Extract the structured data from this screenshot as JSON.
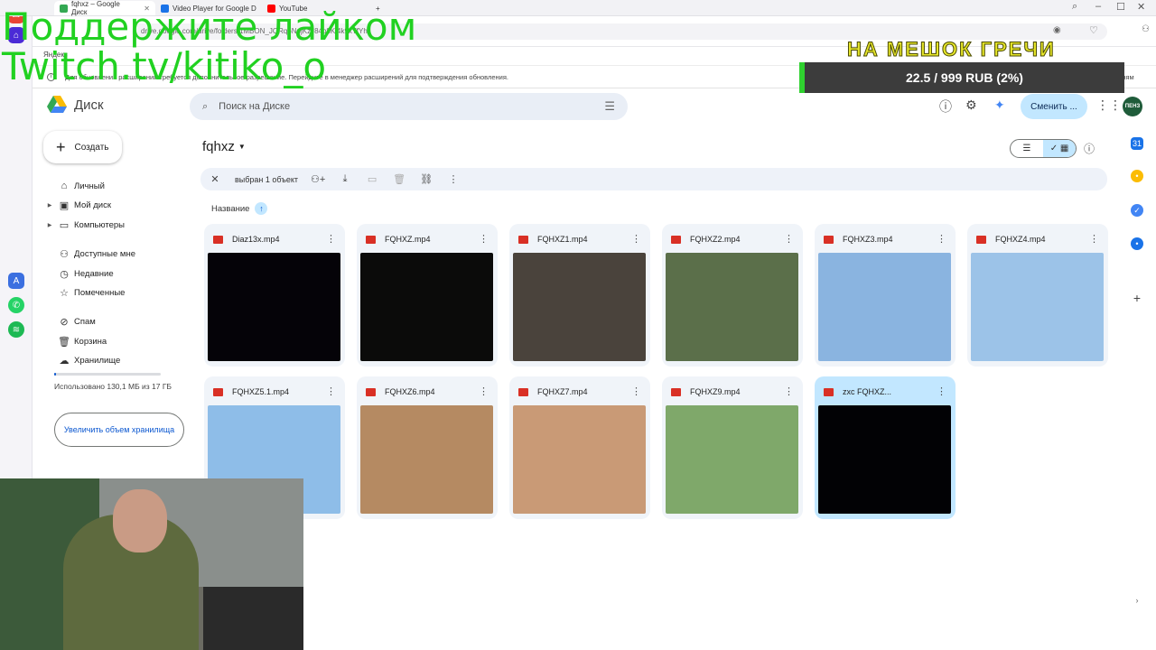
{
  "browser": {
    "tabs": [
      {
        "title": "fqhxz – Google Диск",
        "active": true
      },
      {
        "title": "Video Player for Google D",
        "active": false
      },
      {
        "title": "YouTube",
        "active": false
      }
    ],
    "new_tab": "+",
    "url": "drive.google.com/drive/folders/1MBON_JQRq6NpjKzJ84p8Kj4k9xTfYh",
    "bookmark": "Яндекс",
    "notice": "Для обновления расширений требуется дополнительное разрешение. Перейдите в менеджер расширений для подтверждения обновления.",
    "notice_button": "...ням"
  },
  "drive": {
    "logo": "Диск",
    "search_placeholder": "Поиск на Диске",
    "switch_button": "Сменить ...",
    "account": "ПЕНЗ",
    "create_label": "Создать",
    "nav": [
      {
        "label": "Личный",
        "icon": "home-icon",
        "expand": false
      },
      {
        "label": "Мой диск",
        "icon": "drive-icon",
        "expand": true
      },
      {
        "label": "Компьютеры",
        "icon": "computer-icon",
        "expand": true
      },
      {
        "label": "Доступные мне",
        "icon": "shared-icon",
        "expand": false
      },
      {
        "label": "Недавние",
        "icon": "clock-icon",
        "expand": false
      },
      {
        "label": "Помеченные",
        "icon": "star-icon",
        "expand": false
      },
      {
        "label": "Спам",
        "icon": "spam-icon",
        "expand": false
      },
      {
        "label": "Корзина",
        "icon": "trash-icon",
        "expand": false
      },
      {
        "label": "Хранилище",
        "icon": "cloud-icon",
        "expand": false
      }
    ],
    "storage_used_fraction": 0.008,
    "storage_text": "Использовано 130,1 МБ из 17 ГБ",
    "upgrade_button": "Увеличить объем хранилища",
    "folder_title": "fqhxz",
    "selection_text": "выбран 1 объект",
    "sort_label": "Название",
    "files": [
      {
        "name": "Diaz13x.mp4",
        "thumb": "#050308",
        "selected": false
      },
      {
        "name": "FQHXZ.mp4",
        "thumb": "#0b0b0a",
        "selected": false
      },
      {
        "name": "FQHXZ1.mp4",
        "thumb": "#4a433c",
        "selected": false
      },
      {
        "name": "FQHXZ2.mp4",
        "thumb": "#5b6f4a",
        "selected": false
      },
      {
        "name": "FQHXZ3.mp4",
        "thumb": "#8ab4e0",
        "selected": false
      },
      {
        "name": "FQHXZ4.mp4",
        "thumb": "#9cc3e8",
        "selected": false
      },
      {
        "name": "FQHXZ5.1.mp4",
        "thumb": "#8ebde8",
        "selected": false
      },
      {
        "name": "FQHXZ6.mp4",
        "thumb": "#b58a62",
        "selected": false
      },
      {
        "name": "FQHXZ7.mp4",
        "thumb": "#c99a76",
        "selected": false
      },
      {
        "name": "FQHXZ9.mp4",
        "thumb": "#7fa86a",
        "selected": false
      },
      {
        "name": "zxc FQHXZ...",
        "thumb": "#020205",
        "selected": true
      }
    ]
  },
  "overlay": {
    "line1": "Поддержите лайком",
    "line2": "Twitch.tv/kitiko_o",
    "goal_title": "НА МЕШОК ГРЕЧИ",
    "goal_progress": "22.5 / 999 RUB (2%)"
  }
}
